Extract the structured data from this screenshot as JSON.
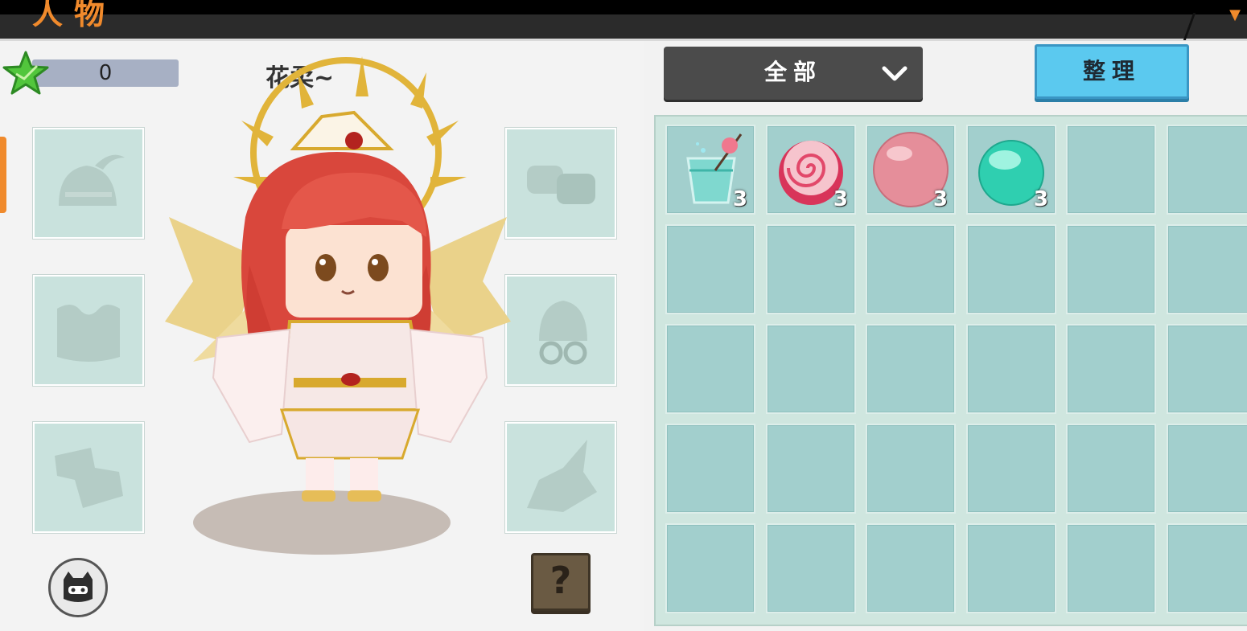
{
  "header": {
    "title": "人物"
  },
  "stars": {
    "icon": "star-icon",
    "value": "0"
  },
  "character": {
    "name": "花柔~"
  },
  "equipment_slots": [
    {
      "name": "helmet-slot",
      "icon": "helmet-icon"
    },
    {
      "name": "armor-slot",
      "icon": "chestplate-icon"
    },
    {
      "name": "boots-slot",
      "icon": "boots-icon"
    },
    {
      "name": "gloves-slot",
      "icon": "gloves-icon"
    },
    {
      "name": "accessory-slot",
      "icon": "glasses-accessory-icon"
    },
    {
      "name": "mount-slot",
      "icon": "dragon-head-icon"
    }
  ],
  "buttons": {
    "filter_label": "全部",
    "sort_label": "整理",
    "help_label": "?"
  },
  "inventory": {
    "columns": 6,
    "rows": 5,
    "items": [
      {
        "name": "candy-drink",
        "icon": "drink-cup-icon",
        "count": "3"
      },
      {
        "name": "swirl-candy",
        "icon": "swirl-candy-icon",
        "count": "3"
      },
      {
        "name": "pink-ball",
        "icon": "pink-ball-icon",
        "count": "3"
      },
      {
        "name": "green-orb",
        "icon": "green-orb-icon",
        "count": "3"
      }
    ]
  },
  "colors": {
    "accent": "#f08a2c",
    "sort_button": "#5bc9ef",
    "slot": "#a2cfcd"
  }
}
